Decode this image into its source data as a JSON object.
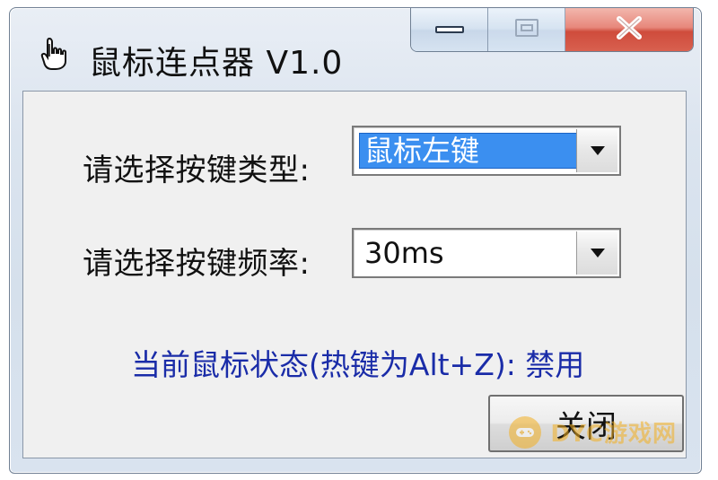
{
  "window": {
    "title": "鼠标连点器 V1.0",
    "icon": "hand-pointer-icon"
  },
  "caption_buttons": {
    "minimize_icon": "minimize-icon",
    "maximize_icon": "maximize-icon",
    "close_icon": "close-icon",
    "close_color": "#d8604f"
  },
  "form": {
    "key_type_label": "请选择按键类型:",
    "key_type_value": "鼠标左键",
    "frequency_label": "请选择按键频率:",
    "frequency_value": "30ms"
  },
  "status": {
    "text": "当前鼠标状态(热键为Alt+Z): 禁用",
    "color": "#1a2ca8"
  },
  "buttons": {
    "close_label": "关闭"
  },
  "watermark": {
    "text": "DYC游戏网"
  },
  "colors": {
    "selection": "#3b8ff0"
  }
}
